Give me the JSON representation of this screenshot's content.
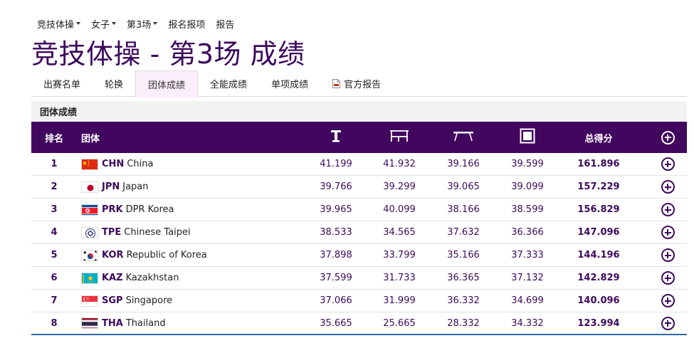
{
  "topnav": {
    "items": [
      {
        "label": "竞技体操",
        "dropdown": true
      },
      {
        "label": "女子",
        "dropdown": true
      },
      {
        "label": "第3场",
        "dropdown": true
      },
      {
        "label": "报名报项",
        "dropdown": false
      },
      {
        "label": "报告",
        "dropdown": false
      }
    ]
  },
  "title": "竞技体操 - 第3场 成绩",
  "tabs": [
    {
      "label": "出赛名单"
    },
    {
      "label": "轮换"
    },
    {
      "label": "团体成绩",
      "active": true
    },
    {
      "label": "全能成绩"
    },
    {
      "label": "单项成绩"
    },
    {
      "label": "官方报告",
      "icon": "pdf-document-icon"
    }
  ],
  "section_title": "团体成绩",
  "table": {
    "headers": {
      "rank": "排名",
      "team": "团体",
      "apparatus_icons": [
        "vault-icon",
        "uneven-bars-icon",
        "balance-beam-icon",
        "floor-exercise-icon"
      ],
      "total": "总得分"
    },
    "rows": [
      {
        "rank": "1",
        "noc": "CHN",
        "country": "China",
        "scores": [
          "41.199",
          "41.932",
          "39.166",
          "39.599"
        ],
        "total": "161.896"
      },
      {
        "rank": "2",
        "noc": "JPN",
        "country": "Japan",
        "scores": [
          "39.766",
          "39.299",
          "39.065",
          "39.099"
        ],
        "total": "157.229"
      },
      {
        "rank": "3",
        "noc": "PRK",
        "country": "DPR Korea",
        "scores": [
          "39.965",
          "40.099",
          "38.166",
          "38.599"
        ],
        "total": "156.829"
      },
      {
        "rank": "4",
        "noc": "TPE",
        "country": "Chinese Taipei",
        "scores": [
          "38.533",
          "34.565",
          "37.632",
          "36.366"
        ],
        "total": "147.096"
      },
      {
        "rank": "5",
        "noc": "KOR",
        "country": "Republic of Korea",
        "scores": [
          "37.898",
          "33.799",
          "35.166",
          "37.333"
        ],
        "total": "144.196"
      },
      {
        "rank": "6",
        "noc": "KAZ",
        "country": "Kazakhstan",
        "scores": [
          "37.599",
          "31.733",
          "36.365",
          "37.132"
        ],
        "total": "142.829"
      },
      {
        "rank": "7",
        "noc": "SGP",
        "country": "Singapore",
        "scores": [
          "37.066",
          "31.999",
          "36.332",
          "34.699"
        ],
        "total": "140.096"
      },
      {
        "rank": "8",
        "noc": "THA",
        "country": "Thailand",
        "scores": [
          "35.665",
          "25.665",
          "28.332",
          "34.332"
        ],
        "total": "123.994"
      }
    ]
  },
  "colors": {
    "header_bg": "#41065e",
    "accent": "#3d0a5c",
    "active_tab_bg": "#fbeefb",
    "bottom_rule": "#2b6aa8"
  }
}
